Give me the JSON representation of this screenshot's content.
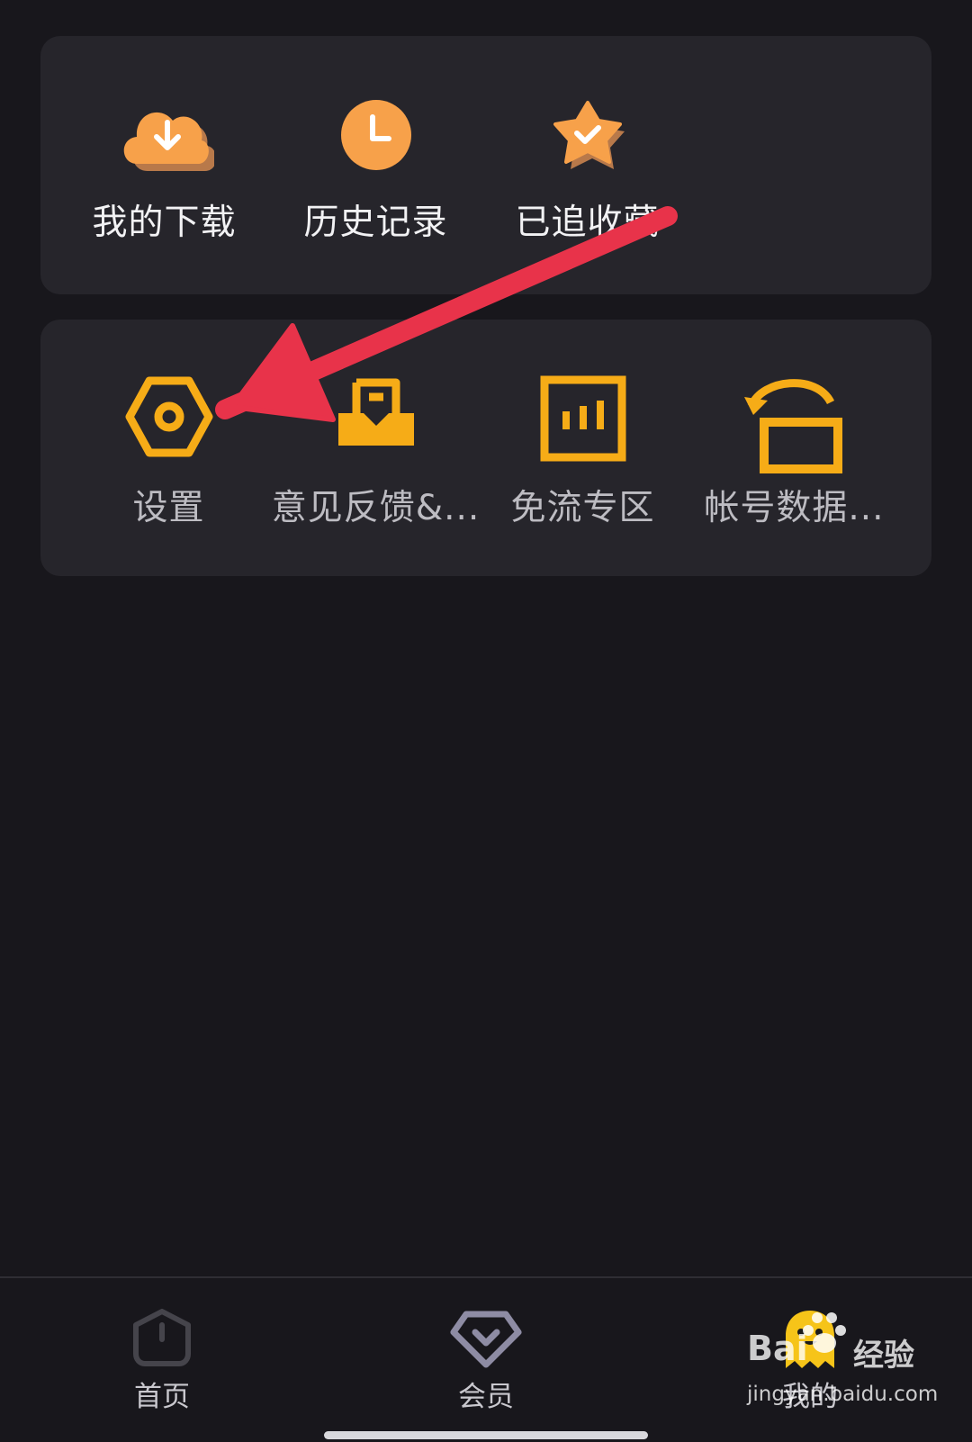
{
  "quick_access": {
    "items": [
      {
        "label": "我的下载",
        "icon": "download-cloud-icon"
      },
      {
        "label": "历史记录",
        "icon": "clock-icon"
      },
      {
        "label": "已追收藏",
        "icon": "star-check-icon"
      }
    ]
  },
  "tools": {
    "items": [
      {
        "label": "设置",
        "icon": "hex-settings-icon"
      },
      {
        "label": "意见反馈&...",
        "icon": "inbox-feedback-icon"
      },
      {
        "label": "免流专区",
        "icon": "bars-zone-icon"
      },
      {
        "label": "帐号数据...",
        "icon": "unlock-data-icon"
      }
    ]
  },
  "tabbar": {
    "items": [
      {
        "label": "首页",
        "icon": "home-icon",
        "active": false
      },
      {
        "label": "会员",
        "icon": "vip-diamond-icon",
        "active": false
      },
      {
        "label": "我的",
        "icon": "mascot-icon",
        "active": true
      }
    ]
  },
  "watermark": {
    "brand": "Bai",
    "brand_cn": "经验",
    "url": "jingyan.baidu.com"
  },
  "colors": {
    "background": "#18171c",
    "card": "#26252b",
    "accent_orange": "#f7a14a",
    "accent_yellow": "#f6ac17",
    "annotation_red": "#e8334a"
  }
}
